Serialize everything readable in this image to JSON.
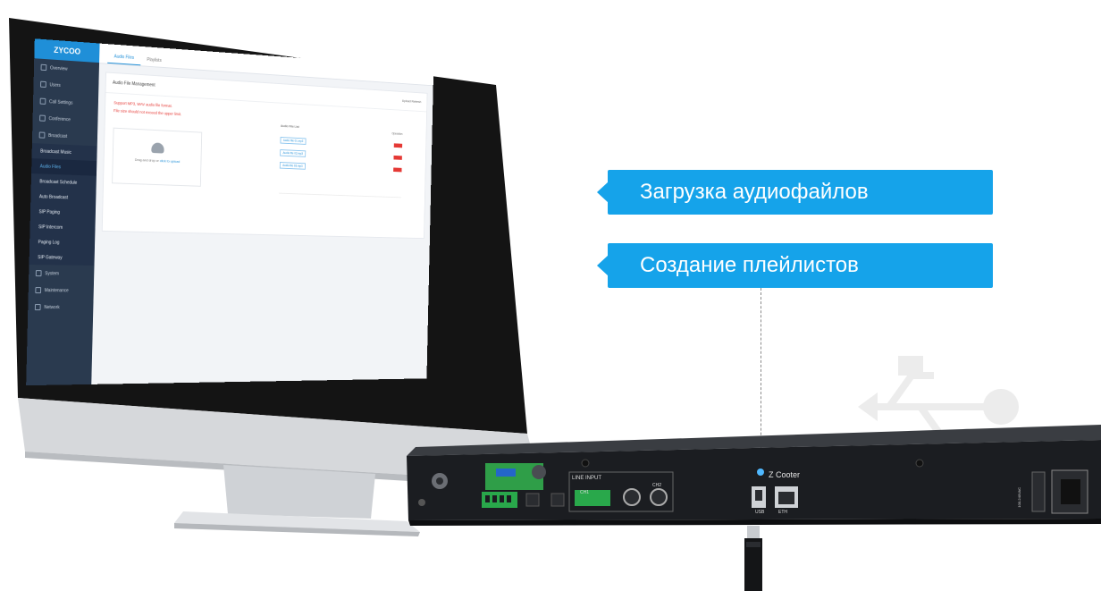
{
  "callouts": {
    "upload": "Загрузка аудиофайлов",
    "playlist": "Создание плейлистов"
  },
  "screen": {
    "logo": "ZYCOO",
    "tabs": [
      "Audio Files",
      "Playlists"
    ],
    "sidebar_items": [
      "Overview",
      "Users",
      "Call Settings",
      "Conference",
      "Broadcast"
    ],
    "sidebar_subitems": [
      "Broadcast Music",
      "Audio Files",
      "Broadcast Schedule",
      "Auto Broadcast",
      "SIP Paging",
      "SIP Intercom",
      "Paging Log",
      "SIP Gateway"
    ],
    "sidebar_bottom": [
      "System",
      "Maintenance",
      "Network"
    ],
    "panel_title": "Audio File Management",
    "panel_actions": "Upload  Refresh",
    "warnings": [
      "Support MP3, WAV audio file format.",
      "File size should not exceed the upper limit."
    ],
    "upload_text": "Drag and drop or",
    "upload_link": "click to upload",
    "playlist_header": "Audio File List",
    "playlist_operation": "Operation",
    "playlist_items": [
      "Audio file 01.mp3",
      "Audio file 02.mp3",
      "Audio file 03.mp3"
    ]
  },
  "device": {
    "line_input_label": "LINE INPUT",
    "channel_labels": [
      "CH1",
      "CH2"
    ],
    "usb_port_label": "USB",
    "eth_port_label": "ETH",
    "brand_label": "Z Cooter",
    "power_label": "100-240VAC"
  },
  "colors": {
    "accent": "#15a3ea",
    "sidebar": "#2a3a4f",
    "warn": "#e53935"
  }
}
